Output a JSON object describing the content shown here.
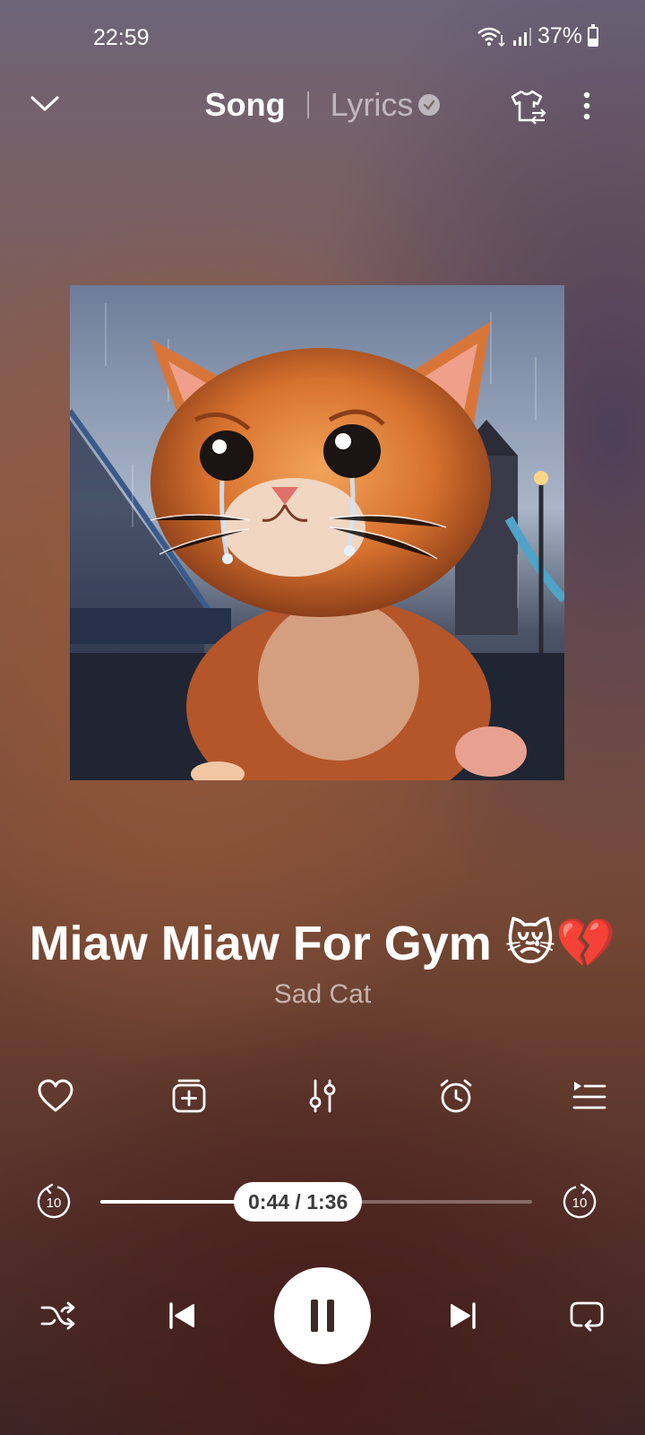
{
  "status": {
    "time": "22:59",
    "battery": "37%",
    "battery_level": 0.37
  },
  "header": {
    "tabs": [
      {
        "label": "Song",
        "active": true
      },
      {
        "label": "Lyrics",
        "active": false
      }
    ],
    "icons": {
      "collapse": "chevron-down-icon",
      "verified": "verified-check-icon",
      "theme": "tshirt-swap-icon",
      "more": "more-vertical-icon"
    }
  },
  "track": {
    "title": "Miaw Miaw For Gym 😿💔",
    "artist": "Sad Cat"
  },
  "actions": [
    {
      "icon": "heart-icon"
    },
    {
      "icon": "add-to-playlist-icon"
    },
    {
      "icon": "equalizer-icon"
    },
    {
      "icon": "sleep-timer-icon"
    },
    {
      "icon": "queue-icon"
    }
  ],
  "progress": {
    "label": "0:44 / 1:36",
    "current_seconds": 44,
    "total_seconds": 96,
    "rewind_label": "10",
    "forward_label": "10"
  },
  "transport": {
    "icons": [
      "shuffle-icon",
      "previous-icon",
      "pause-icon",
      "next-icon",
      "repeat-icon"
    ]
  },
  "colors": {
    "foreground": "#ffffff",
    "pill_text": "#3b3b3b"
  }
}
